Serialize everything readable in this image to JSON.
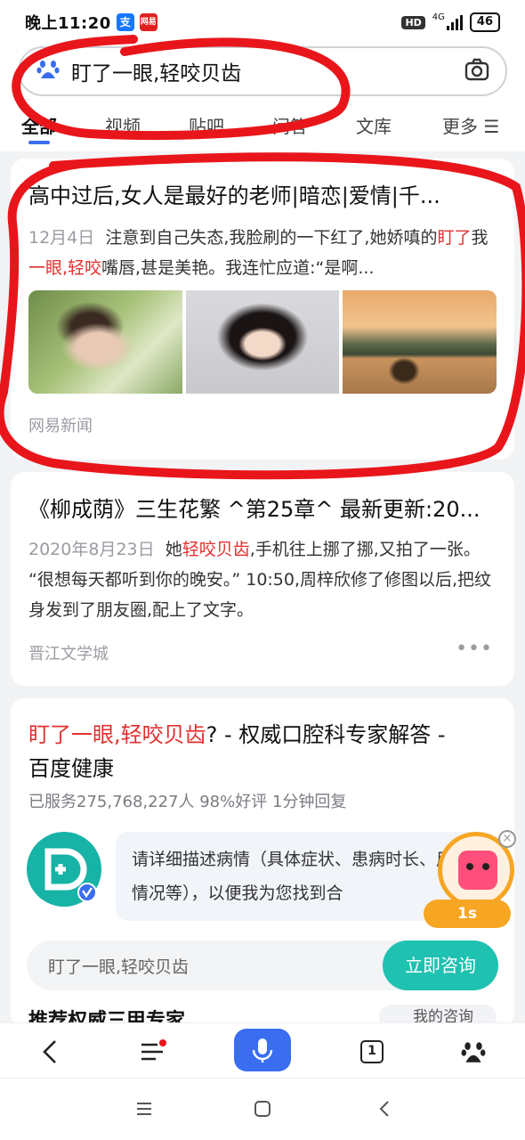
{
  "status_bar": {
    "time": "晚上11:20",
    "hd": "HD",
    "network": "4G",
    "battery": "46"
  },
  "search": {
    "query": "盯了一眼,轻咬贝齿",
    "icons": {
      "logo": "baidu-paw-icon",
      "camera": "camera-icon"
    }
  },
  "tabs": [
    {
      "label": "全部",
      "active": true
    },
    {
      "label": "视频",
      "active": false
    },
    {
      "label": "贴吧",
      "active": false
    },
    {
      "label": "问答",
      "active": false
    },
    {
      "label": "文库",
      "active": false
    },
    {
      "label": "更多 ☰",
      "active": false
    }
  ],
  "results": [
    {
      "title": "高中过后,女人是最好的老师|暗恋|爱情|千...",
      "date": "12月4日",
      "snippet_parts": [
        {
          "t": "注意到自己失态,我脸刷的一下红了,她娇嗔的",
          "hl": false
        },
        {
          "t": "盯了",
          "hl": true
        },
        {
          "t": "我",
          "hl": false
        },
        {
          "t": "一眼,轻咬",
          "hl": true
        },
        {
          "t": "嘴唇,甚是美艳。我连忙应道:“是啊...",
          "hl": false
        }
      ],
      "images": [
        "woman-in-garden",
        "woman-portrait",
        "lake-sunset-boat"
      ],
      "source": "网易新闻"
    },
    {
      "title": "《柳成荫》三生花繁 ^第25章^ 最新更新:20...",
      "date": "2020年8月23日",
      "snippet_parts": [
        {
          "t": "她",
          "hl": false
        },
        {
          "t": "轻咬贝齿",
          "hl": true
        },
        {
          "t": ",手机往上挪了挪,又拍了一张。 “很想每天都听到你的晚安。” 10:50,周梓欣修了修图以后,把纹身发到了朋友圈,配上了文字。",
          "hl": false
        }
      ],
      "source": "晋江文学城",
      "more": "•••"
    },
    {
      "title_hl": "盯了一眼,轻咬贝齿",
      "title_rest": "? - 权威口腔科专家解答 -",
      "title_line2": "百度健康",
      "stats": "已服务275,768,227人  98%好评  1分钟回复",
      "bubble": "请详细描述病情（具体症状、患病时长、用药情况等），以便我为您找到合",
      "timer": "1s",
      "input_placeholder": "盯了一眼,轻咬贝齿",
      "consult_label": "立即咨询",
      "partial_heading": "推荐权威三甲专家",
      "partial_tag": "我的咨询"
    }
  ],
  "bottom_nav": {
    "tab_count": "1",
    "icons": [
      "back-icon",
      "menu-icon",
      "microphone-icon",
      "tabs-icon",
      "baidu-paw-icon"
    ]
  },
  "colors": {
    "accent": "#3a6df0",
    "highlight": "#e0312f",
    "consult": "#1fc1b0",
    "annotation": "#e8161b"
  }
}
